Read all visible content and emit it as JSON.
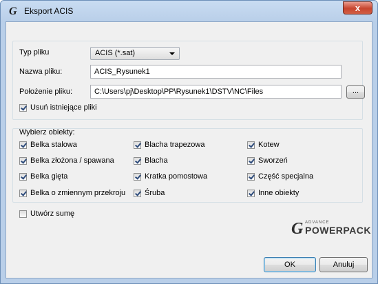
{
  "window": {
    "title": "Eksport ACIS",
    "logo_glyph": "G",
    "close_glyph": "x"
  },
  "form": {
    "file_type_label": "Typ pliku",
    "file_type_value": "ACIS (*.sat)",
    "file_name_label": "Nazwa pliku:",
    "file_name_value": "ACIS_Rysunek1",
    "location_label": "Położenie pliku:",
    "location_value": "C:\\Users\\pj\\Desktop\\PP\\Rysunek1\\DSTV\\NC\\Files",
    "browse_label": "...",
    "delete_existing_label": "Usuń istniejące pliki",
    "delete_existing_checked": true
  },
  "objects": {
    "group_label": "Wybierz obiekty:",
    "items": [
      {
        "label": "Belka stalowa",
        "checked": true
      },
      {
        "label": "Belka złożona / spawana",
        "checked": true
      },
      {
        "label": "Belka gięta",
        "checked": true
      },
      {
        "label": "Belka o zmiennym przekroju",
        "checked": true
      },
      {
        "label": "Blacha trapezowa",
        "checked": true
      },
      {
        "label": "Blacha",
        "checked": true
      },
      {
        "label": "Kratka pomostowa",
        "checked": true
      },
      {
        "label": "Śruba",
        "checked": true
      },
      {
        "label": "Kotew",
        "checked": true
      },
      {
        "label": "Sworzeń",
        "checked": true
      },
      {
        "label": "Część specjalna",
        "checked": true
      },
      {
        "label": "Inne obiekty",
        "checked": true
      }
    ]
  },
  "create_sum": {
    "label": "Utwórz sumę",
    "checked": false
  },
  "brand": {
    "glyph": "G",
    "advance": "ADVANCE",
    "name": "POWERPACK"
  },
  "buttons": {
    "ok": "OK",
    "cancel": "Anuluj"
  },
  "colors": {
    "title_gradient_top": "#c9dcf2",
    "close_red": "#c7452f",
    "dialog_bg": "#f0f0f0",
    "check_mark": "#2c4a7a"
  }
}
